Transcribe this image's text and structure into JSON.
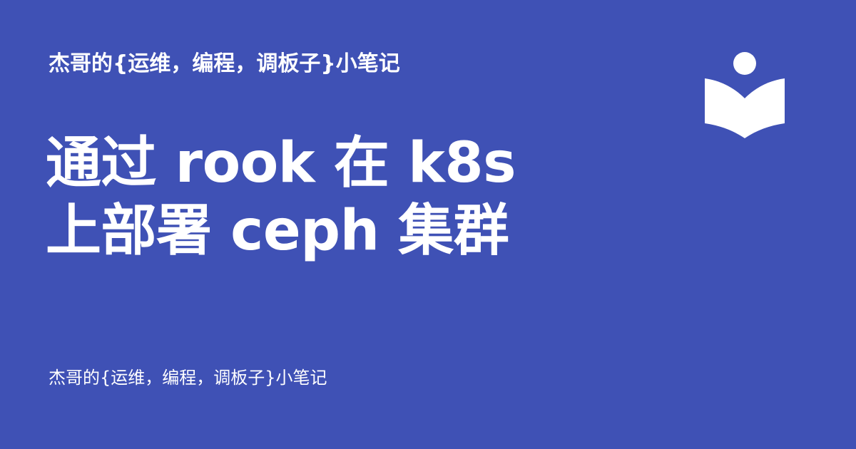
{
  "site": {
    "title": "杰哥的{运维，编程，调板子}小笔记",
    "footer_title": "杰哥的{运维，编程，调板子}小笔记",
    "logo_icon": "open-book-reader-icon"
  },
  "post": {
    "title_line1": "通过 rook 在 k8s",
    "title_line2": "上部署 ceph 集群"
  },
  "colors": {
    "background": "#3f51b5",
    "foreground": "#ffffff"
  }
}
